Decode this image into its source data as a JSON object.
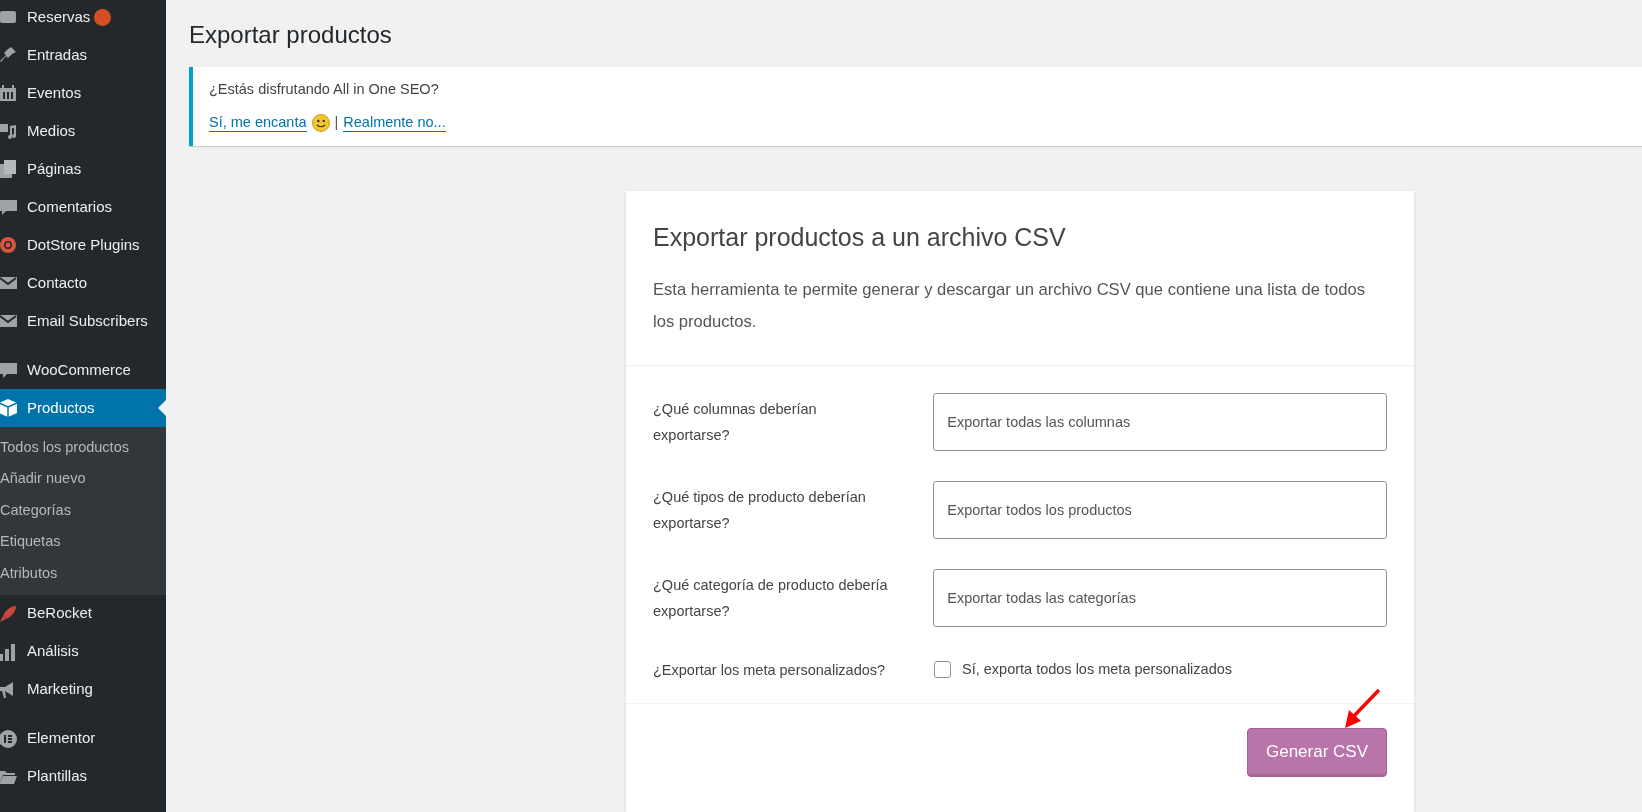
{
  "sidebar": {
    "groups": [
      [
        {
          "label": "Reservas",
          "badge": true,
          "selected": false
        },
        {
          "label": "Entradas",
          "selected": false
        },
        {
          "label": "Eventos",
          "selected": false
        },
        {
          "label": "Medios",
          "selected": false
        },
        {
          "label": "Páginas",
          "selected": false
        },
        {
          "label": "Comentarios",
          "selected": false
        },
        {
          "label": "DotStore Plugins",
          "selected": false
        },
        {
          "label": "Contacto",
          "selected": false
        },
        {
          "label": "Email Subscribers",
          "selected": false
        }
      ],
      [
        {
          "label": "WooCommerce",
          "selected": false
        },
        {
          "label": "Productos",
          "selected": true,
          "children": [
            "Todos los productos",
            "Añadir nuevo",
            "Categorías",
            "Etiquetas",
            "Atributos"
          ]
        },
        {
          "label": "BeRocket",
          "selected": false
        },
        {
          "label": "Análisis",
          "selected": false
        },
        {
          "label": "Marketing",
          "selected": false
        }
      ],
      [
        {
          "label": "Elementor",
          "selected": false
        },
        {
          "label": "Plantillas",
          "selected": false
        }
      ]
    ]
  },
  "page_title": "Exportar productos",
  "notice": {
    "question": "¿Estás disfrutando All in One SEO?",
    "links": [
      "Sí, me encanta",
      "Realmente no..."
    ],
    "separator": "|"
  },
  "card": {
    "title": "Exportar productos a un archivo CSV",
    "description": "Esta herramienta te permite generar y descargar un archivo CSV que contiene una lista de todos los productos.",
    "fields": [
      {
        "kind": "select",
        "label": "¿Qué columnas deberían exportarse?",
        "placeholder": "Exportar todas las columnas"
      },
      {
        "kind": "select",
        "label": "¿Qué tipos de producto deberían exportarse?",
        "placeholder": "Exportar todos los productos"
      },
      {
        "kind": "select",
        "label": "¿Qué categoría de producto debería exportarse?",
        "placeholder": "Exportar todas las categorías"
      },
      {
        "kind": "checkbox",
        "label": "¿Exportar los meta personalizados?",
        "option": "Sí, exporta todos los meta personalizados",
        "checked": false
      }
    ],
    "button": "Generar CSV"
  }
}
